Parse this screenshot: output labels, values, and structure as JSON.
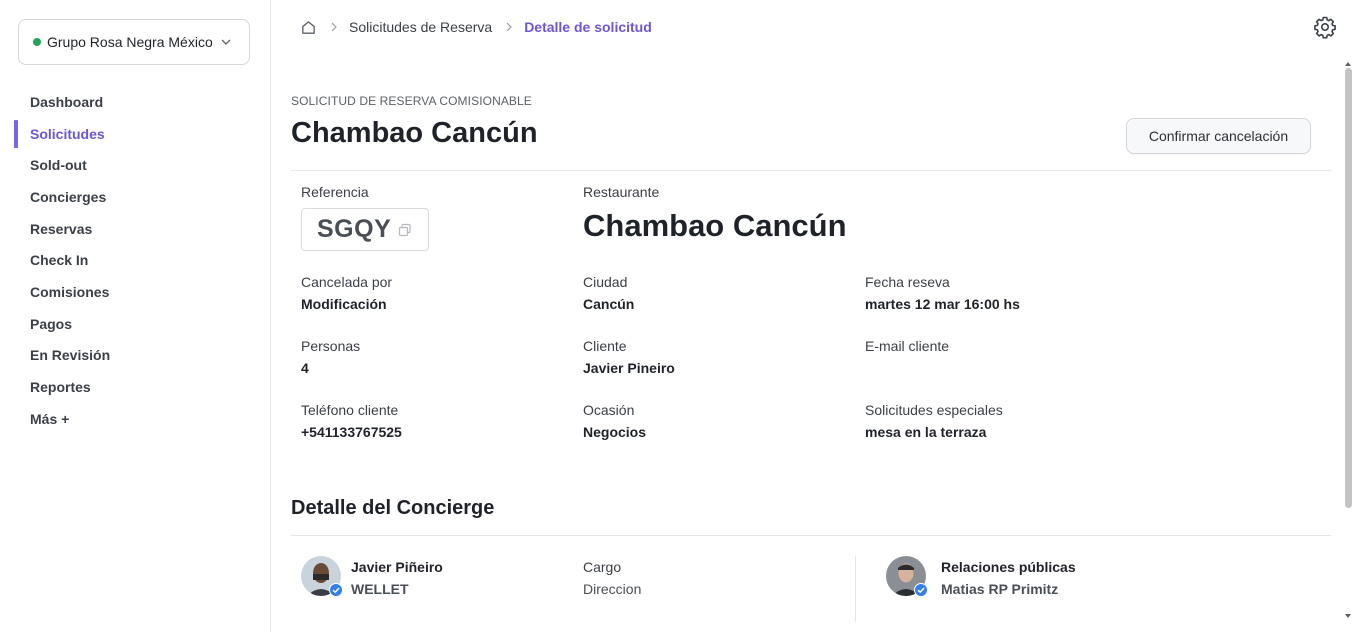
{
  "sidebar": {
    "org": {
      "name": "Grupo Rosa Negra México",
      "status_color": "#22a55a"
    },
    "items": [
      {
        "label": "Dashboard"
      },
      {
        "label": "Solicitudes",
        "active": true
      },
      {
        "label": "Sold-out"
      },
      {
        "label": "Concierges"
      },
      {
        "label": "Reservas"
      },
      {
        "label": "Check In"
      },
      {
        "label": "Comisiones"
      },
      {
        "label": "Pagos"
      },
      {
        "label": "En Revisión"
      },
      {
        "label": "Reportes"
      },
      {
        "label": "Más +"
      }
    ]
  },
  "breadcrumb": {
    "home_icon": "home-icon",
    "items": [
      "Solicitudes de Reserva",
      "Detalle de solicitud"
    ]
  },
  "header": {
    "settings_icon": "gear-icon"
  },
  "request": {
    "eyebrow": "SOLICITUD DE RESERVA COMISIONABLE",
    "title": "Chambao Cancún",
    "cancel_button": "Confirmar cancelación",
    "reference": {
      "label": "Referencia",
      "value": "SGQY"
    },
    "restaurant": {
      "label": "Restaurante",
      "value": "Chambao Cancún"
    },
    "fields": {
      "cancelled_by": {
        "label": "Cancelada por",
        "value": "Modificación"
      },
      "city": {
        "label": "Ciudad",
        "value": "Cancún"
      },
      "date": {
        "label": "Fecha reseva",
        "value": "martes 12 mar 16:00 hs"
      },
      "people": {
        "label": "Personas",
        "value": "4"
      },
      "client": {
        "label": "Cliente",
        "value": "Javier Pineiro"
      },
      "email": {
        "label": "E-mail cliente",
        "value": ""
      },
      "phone": {
        "label": "Teléfono cliente",
        "value": "+541133767525"
      },
      "occasion": {
        "label": "Ocasión",
        "value": "Negocios"
      },
      "special": {
        "label": "Solicitudes especiales",
        "value": "mesa en la terraza"
      }
    }
  },
  "concierge": {
    "section_title": "Detalle del Concierge",
    "person": {
      "name": "Javier Piñeiro",
      "company": "WELLET"
    },
    "role": {
      "label": "Cargo",
      "value": "Direccion"
    },
    "pr": {
      "title": "Relaciones públicas",
      "name": "Matias RP Primitz"
    },
    "accent_color": "#6a55e2",
    "verified_color": "#2f80ed"
  }
}
